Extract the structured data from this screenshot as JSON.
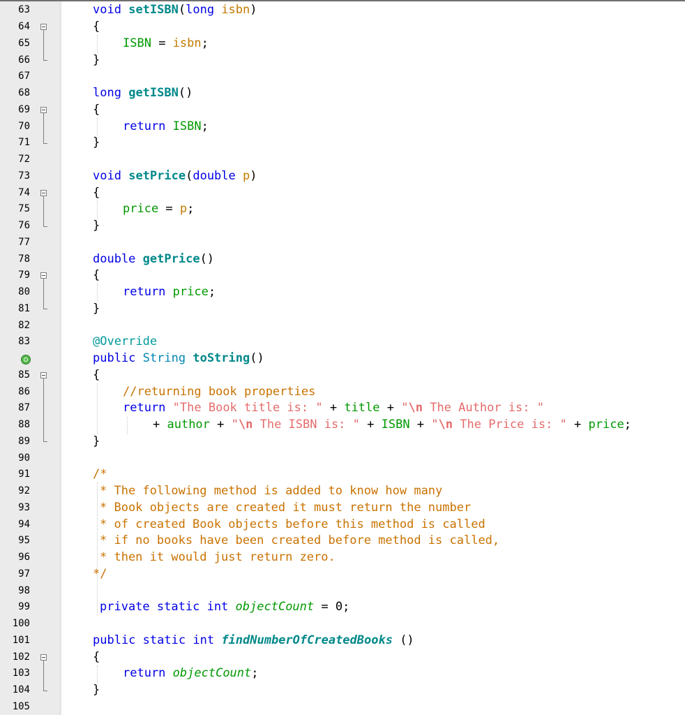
{
  "gutter": {
    "line_numbers": [
      "63",
      "64",
      "65",
      "66",
      "67",
      "68",
      "69",
      "70",
      "71",
      "72",
      "73",
      "74",
      "75",
      "76",
      "77",
      "78",
      "79",
      "80",
      "81",
      "82",
      "83",
      "",
      "85",
      "86",
      "87",
      "88",
      "89",
      "90",
      "91",
      "92",
      "93",
      "94",
      "95",
      "96",
      "97",
      "98",
      "99",
      "100",
      "101",
      "102",
      "103",
      "104",
      "105"
    ]
  },
  "code": {
    "setIsbn": {
      "kw": "void",
      "name": "setISBN",
      "open": "(",
      "ptype": "long",
      "pname": "isbn",
      "close": ")"
    },
    "open_brace": "{",
    "close_brace": "}",
    "setIsbnBody": {
      "field": "ISBN",
      "eq": " = ",
      "value": "isbn",
      "semi": ";"
    },
    "getIsbn": {
      "kw": "long",
      "name": "getISBN",
      "parens": "()"
    },
    "getIsbnBody": {
      "kw": "return",
      "field": "ISBN",
      "semi": ";"
    },
    "setPrice": {
      "kw": "void",
      "name": "setPrice",
      "open": "(",
      "ptype": "double",
      "pname": "p",
      "close": ")"
    },
    "setPriceBody": {
      "field": "price",
      "eq": " = ",
      "value": "p",
      "semi": ";"
    },
    "getPrice": {
      "kw": "double",
      "name": "getPrice",
      "parens": "()"
    },
    "getPriceBody": {
      "kw": "return",
      "field": "price",
      "semi": ";"
    },
    "annotation": "@Override",
    "toString": {
      "kw": "public",
      "type": "String",
      "name": "toString",
      "parens": "()"
    },
    "comment_line": "//returning book properties",
    "return1": {
      "kw": "return",
      "s1": "\"The Book title is: \"",
      "plus1": " + ",
      "f1": "title",
      "plus2": " + ",
      "s2a": "\"",
      "s2esc": "\\n",
      "s2b": " The Author is: \""
    },
    "return2": {
      "plus0": "+ ",
      "f1": "author",
      "plus1": " + ",
      "s1a": "\"",
      "s1esc": "\\n",
      "s1b": " The ISBN is: \"",
      "plus2": " + ",
      "f2": "ISBN",
      "plus3": " + ",
      "s2a": "\"",
      "s2esc": "\\n",
      "s2b": " The Price is: \"",
      "plus4": " + ",
      "f3": "price",
      "semi": ";"
    },
    "block_comment": [
      "/*",
      "* The following method is added to know how many",
      "* Book objects are created it must return the number",
      "* of created Book objects before this method is called",
      "* if no books have been created before method is called,",
      "* then it would just return zero.",
      "*/"
    ],
    "objectCount": {
      "kw1": "private",
      "kw2": "static",
      "kw3": "int",
      "name": "objectCount",
      "eq": " = ",
      "value": "0",
      "semi": ";"
    },
    "findNumber": {
      "kw1": "public",
      "kw2": "static",
      "kw3": "int",
      "name": "findNumberOfCreatedBooks",
      "parens": " ()"
    },
    "findBody": {
      "kw": "return",
      "field": "objectCount",
      "semi": ";"
    }
  },
  "colors": {
    "keyword": "#0000e6",
    "method": "#00888a",
    "field": "#009900",
    "string": "#e56b6b",
    "comment": "#c97200",
    "gutter_bg": "#ebebeb"
  },
  "icons": {
    "fold": "fold-minus-icon",
    "override": "override-marker-icon"
  }
}
